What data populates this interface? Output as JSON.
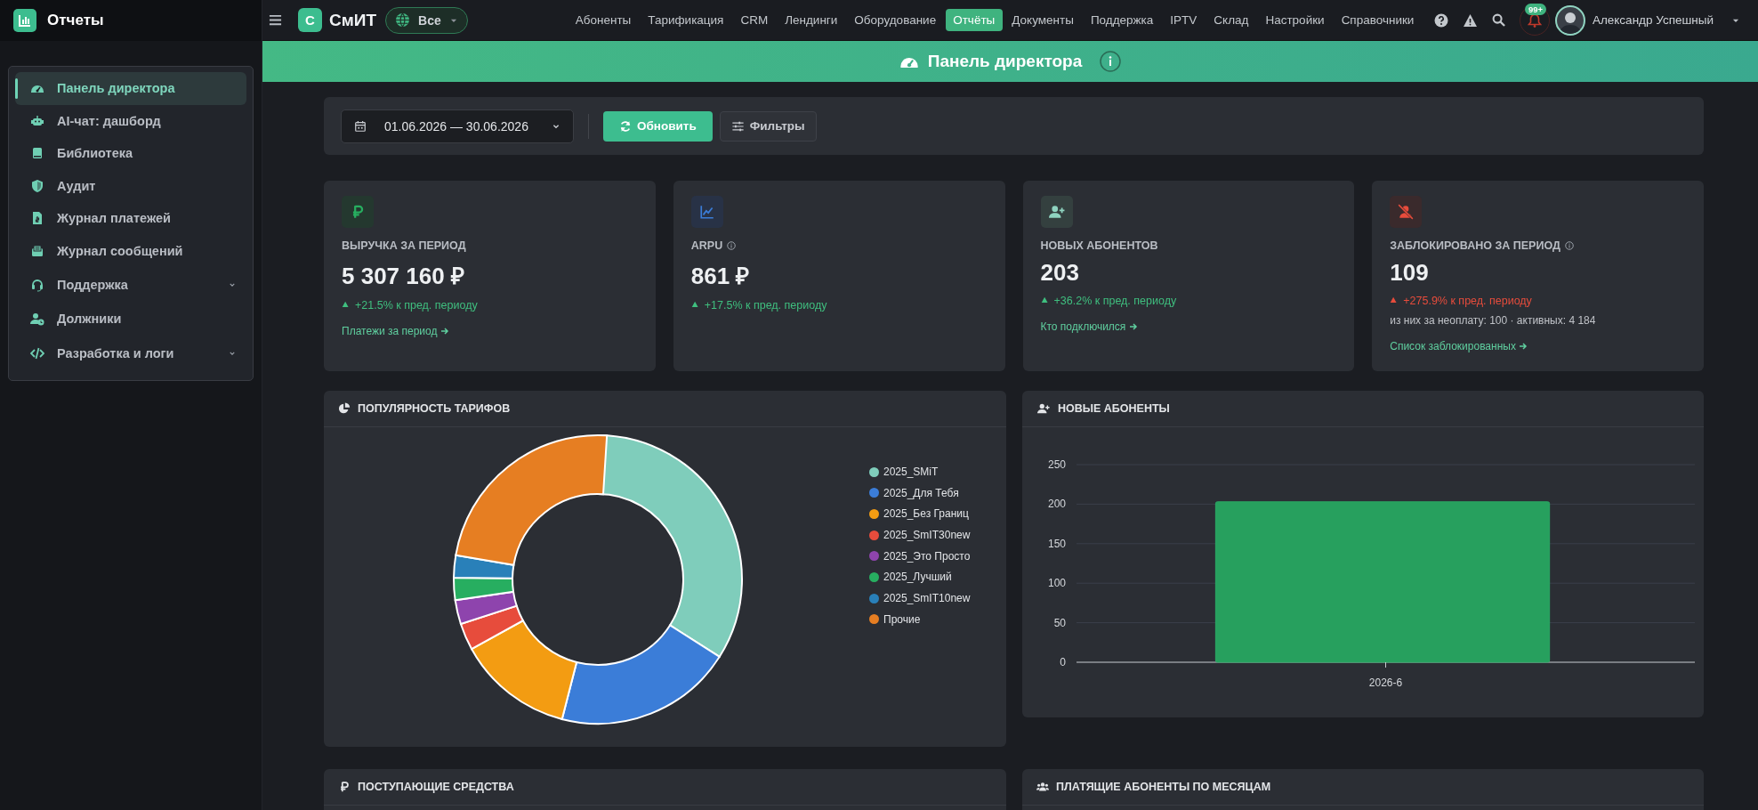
{
  "sidebar": {
    "title": "Отчеты",
    "items": [
      {
        "label": "Панель директора",
        "kind": "link",
        "selected": true
      },
      {
        "label": "AI-чат: дашборд",
        "kind": "link",
        "selected": false
      },
      {
        "label": "Библиотека",
        "kind": "link",
        "selected": false
      },
      {
        "label": "Аудит",
        "kind": "link",
        "selected": false
      },
      {
        "label": "Журнал платежей",
        "kind": "link",
        "selected": false
      },
      {
        "label": "Журнал сообщений",
        "kind": "link",
        "selected": false
      },
      {
        "label": "Поддержка",
        "kind": "group",
        "selected": false
      },
      {
        "label": "Должники",
        "kind": "link",
        "selected": false
      },
      {
        "label": "Разработка и логи",
        "kind": "group",
        "selected": false
      }
    ]
  },
  "topbar": {
    "logo_letter": "С",
    "brand": "СмИТ",
    "region": "Все",
    "nav": [
      {
        "label": "Абоненты",
        "selected": false
      },
      {
        "label": "Тарификация",
        "selected": false
      },
      {
        "label": "CRM",
        "selected": false
      },
      {
        "label": "Лендинги",
        "selected": false
      },
      {
        "label": "Оборудование",
        "selected": false
      },
      {
        "label": "Отчёты",
        "selected": true
      },
      {
        "label": "Документы",
        "selected": false
      },
      {
        "label": "Поддержка",
        "selected": false
      },
      {
        "label": "IPTV",
        "selected": false
      },
      {
        "label": "Склад",
        "selected": false
      },
      {
        "label": "Настройки",
        "selected": false
      },
      {
        "label": "Справочники",
        "selected": false
      }
    ],
    "notifications": "99+",
    "user": "Александр Успешный"
  },
  "banner": {
    "title": "Панель директора"
  },
  "toolbar": {
    "date_range": "01.06.2026 — 30.06.2026",
    "refresh": "Обновить",
    "filters": "Фильтры"
  },
  "kpis": [
    {
      "kind": "revenue",
      "label": "ВЫРУЧКА ЗА ПЕРИОД",
      "info": false,
      "value": "5 307 160 ₽",
      "rising": true,
      "positive": true,
      "delta": "+21.5% к пред. периоду",
      "link": "Платежи за период"
    },
    {
      "kind": "arpu",
      "label": "ARPU",
      "info": true,
      "value": "861 ₽",
      "rising": true,
      "positive": true,
      "delta": "+17.5% к пред. периоду"
    },
    {
      "kind": "new",
      "label": "НОВЫХ АБОНЕНТОВ",
      "info": false,
      "value": "203",
      "rising": true,
      "positive": true,
      "delta": "+36.2% к пред. периоду",
      "link": "Кто подключился"
    },
    {
      "kind": "blocked",
      "label": "ЗАБЛОКИРОВАНО ЗА ПЕРИОД",
      "info": true,
      "value": "109",
      "rising": true,
      "positive": false,
      "delta": "+275.9% к пред. периоду",
      "note": "из них за неоплату: 100 · активных: 4 184",
      "link": "Список заблокированных"
    }
  ],
  "tariffs": {
    "title": "ПОПУЛЯРНОСТЬ ТАРИФОВ",
    "legend": [
      {
        "label": "2025_SMiT",
        "color": "#7fcdbb"
      },
      {
        "label": "2025_Для Тебя",
        "color": "#3b7dd8"
      },
      {
        "label": "2025_Без Границ",
        "color": "#f39c12"
      },
      {
        "label": "2025_SmIT30new",
        "color": "#e74c3c"
      },
      {
        "label": "2025_Это Просто",
        "color": "#8e44ad"
      },
      {
        "label": "2025_Лучший",
        "color": "#27ae60"
      },
      {
        "label": "2025_SmIT10new",
        "color": "#2980b9"
      },
      {
        "label": "Прочие",
        "color": "#e67e22"
      }
    ]
  },
  "new_subscribers": {
    "title": "НОВЫЕ АБОНЕНТЫ",
    "chart_data": {
      "type": "bar",
      "categories": [
        "2026-6"
      ],
      "values": [
        203
      ],
      "ylim": [
        0,
        250
      ],
      "grid": true,
      "yticks": [
        0,
        50,
        100,
        150,
        200,
        250
      ]
    }
  },
  "sections": [
    {
      "kind": "income",
      "title": "ПОСТУПАЮЩИЕ СРЕДСТВА"
    },
    {
      "kind": "paying",
      "title": "ПЛАТЯЩИЕ АБОНЕНТЫ ПО МЕСЯЦАМ"
    }
  ]
}
